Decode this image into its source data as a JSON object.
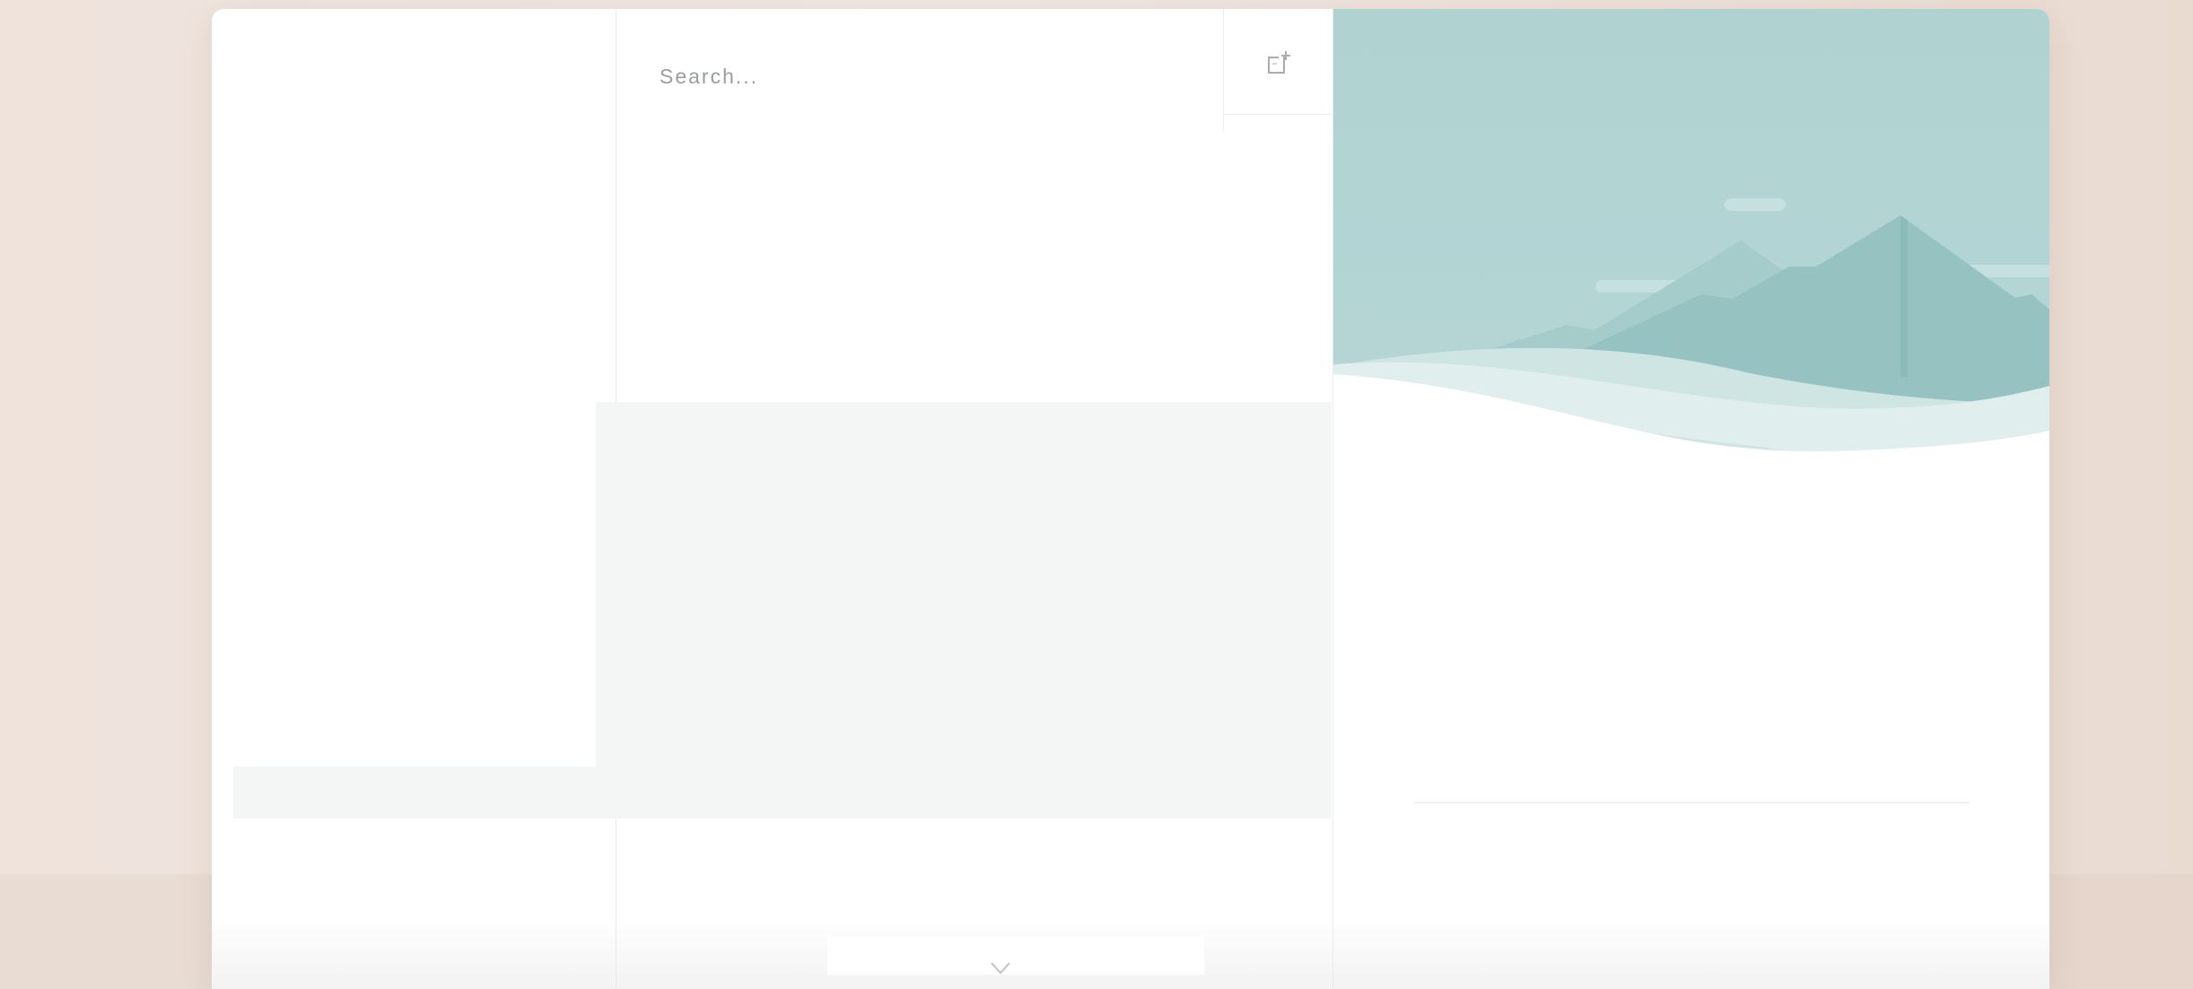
{
  "search": {
    "placeholder": "Search..."
  },
  "toolbar": {
    "compose_icon": "new-note-icon"
  },
  "list": {
    "expand_icon": "chevron-down-icon"
  },
  "detail": {
    "illustration": "mountain-landscape-illustration"
  },
  "colors": {
    "background": "#efe3dc",
    "accent_teal": "#b2d4d3",
    "mountain_teal": "#96c1c0",
    "selection_gray": "#f4f5f5"
  }
}
